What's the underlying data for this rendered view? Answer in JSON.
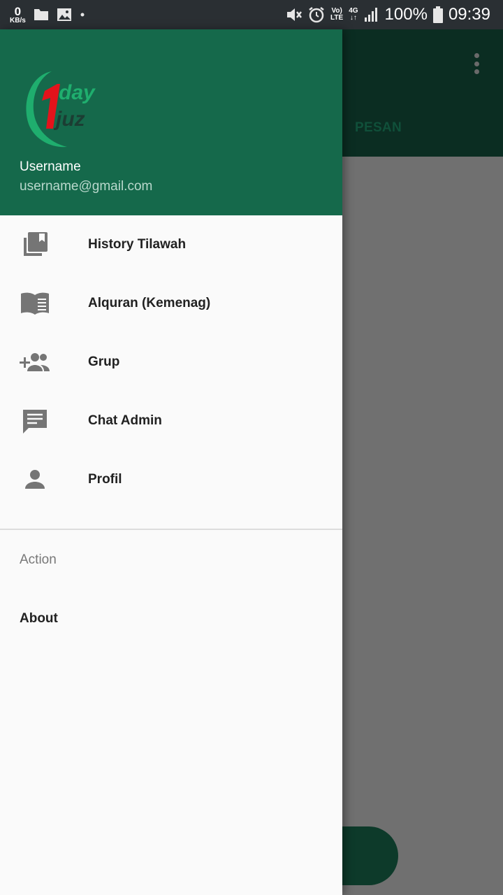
{
  "status_bar": {
    "net_speed_value": "0",
    "net_speed_unit": "KB/s",
    "volte_top": "Vo)",
    "volte_bottom": "LTE",
    "network_top": "4G",
    "network_bottom": "↓↑",
    "battery": "100%",
    "time": "09:39",
    "icons": [
      "folder-icon",
      "image-icon",
      "dot-icon",
      "mute-icon",
      "alarm-icon",
      "signal-icon",
      "battery-icon"
    ]
  },
  "app": {
    "tab_label": "PESAN",
    "toolbar_color": "#0b2d22"
  },
  "drawer": {
    "header_color": "#15694b",
    "logo": {
      "top_text": "day",
      "bottom_text": "juz",
      "digit": "1"
    },
    "username": "Username",
    "email": "username@gmail.com",
    "items": [
      {
        "label": "History Tilawah",
        "icon": "history-book-icon"
      },
      {
        "label": "Alquran (Kemenag)",
        "icon": "open-book-icon"
      },
      {
        "label": "Grup",
        "icon": "group-add-icon"
      },
      {
        "label": "Chat Admin",
        "icon": "chat-icon"
      },
      {
        "label": "Profil",
        "icon": "person-icon"
      }
    ],
    "section_title": "Action",
    "section_items": [
      {
        "label": "About"
      }
    ]
  }
}
